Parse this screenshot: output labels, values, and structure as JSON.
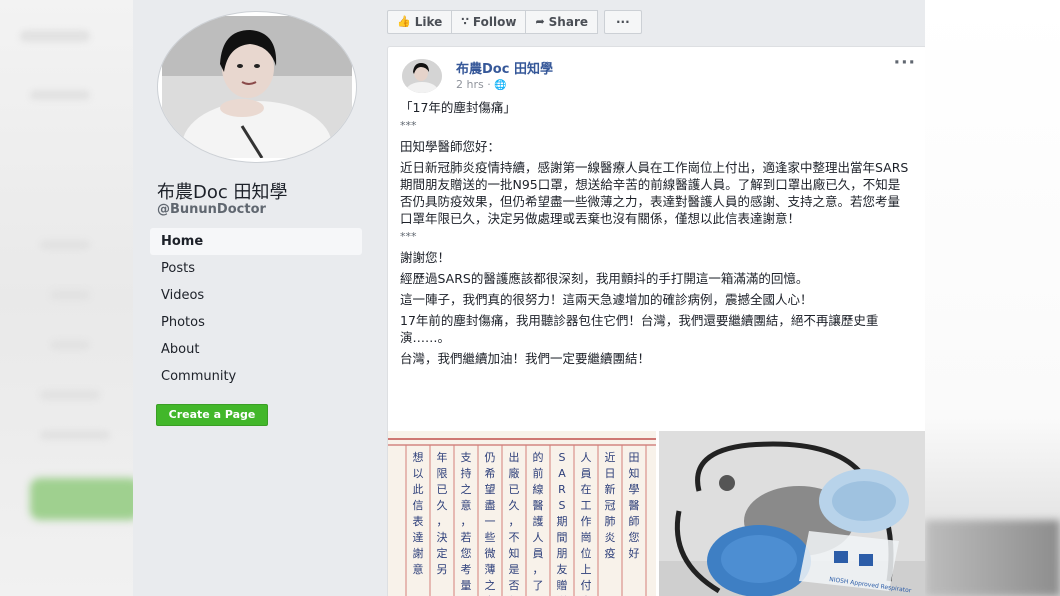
{
  "page": {
    "name": "布農Doc 田知學",
    "handle": "@BununDoctor",
    "nav": [
      "Home",
      "Posts",
      "Videos",
      "Photos",
      "About",
      "Community"
    ],
    "active_nav": "Home",
    "create_page_label": "Create a Page"
  },
  "actions": {
    "like_label": "Like",
    "follow_label": "Follow",
    "share_label": "Share",
    "more_label": "···"
  },
  "post": {
    "author": "布農Doc 田知學",
    "time": "2 hrs ·",
    "more_label": "···",
    "title": "「17年的塵封傷痛」",
    "stars": "***",
    "greeting": "田知學醫師您好：",
    "letter": "近日新冠肺炎疫情持續，感謝第一線醫療人員在工作崗位上付出，適逢家中整理出當年SARS期間朋友贈送的一批N95口罩，想送給辛苦的前線醫護人員。了解到口罩出廠已久，不知是否仍具防疫效果，但仍希望盡一些微薄之力，表達對醫護人員的感謝、支持之意。若您考量口罩年限已久，決定另做處理或丟棄也沒有關係，僅想以此信表達謝意！",
    "stars2": "***",
    "p1": "謝謝您！",
    "p2": "經歷過SARS的醫護應該都很深刻，我用顫抖的手打開這一箱滿滿的回憶。",
    "p3": "這一陣子，我們真的很努力！這兩天急遽增加的確診病例，震撼全國人心！",
    "p4": "17年前的塵封傷痛，我用聽診器包住它們！台灣，我們還要繼續團結，絕不再讓歷史重演……。",
    "p5": "台灣，我們繼續加油！我們一定要繼續團結！"
  },
  "handwritten_letter": [
    "田知學醫師您好",
    "近日新冠肺炎疫",
    "人員在工作崗位上付出",
    "SARS期間朋友贈送的",
    "的前線醫護人員，了",
    "出廠已久，不知是否仍",
    "仍希望盡一些微薄之力",
    "支持之意，若您考量口",
    "年限已久，決定另",
    "想以此信表達謝意"
  ],
  "mask_label": "NIOSH Approved Respirator"
}
